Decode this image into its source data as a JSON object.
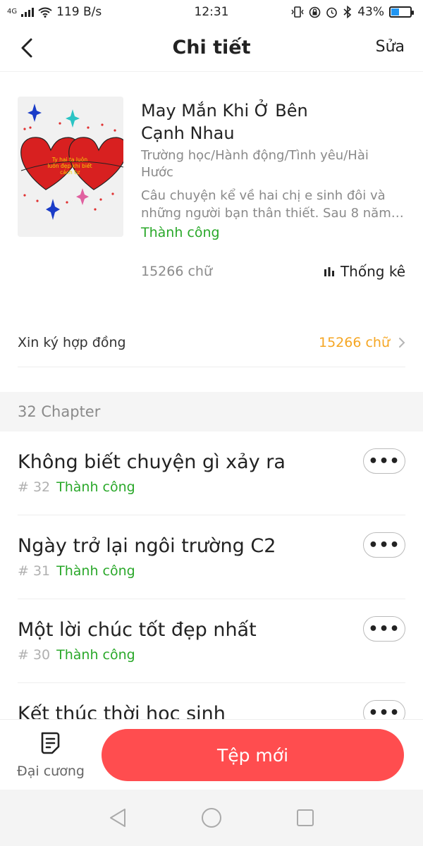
{
  "status_bar": {
    "network_type": "4G",
    "net_speed": "119 B/s",
    "time": "12:31",
    "battery_percent": "43%",
    "battery_level": 0.43,
    "battery_color": "#2196f3"
  },
  "header": {
    "title": "Chi tiết",
    "edit_label": "Sửa"
  },
  "book": {
    "cover_text": "Ty hai ta luôn luôn đẹp khi biết cách tự",
    "title": "May Mắn Khi Ở Bên Cạnh Nhau",
    "genres": "Trường học/Hành động/Tình yêu/Hài Hước",
    "description": "Câu chuyện kể về hai chị e sinh đôi và những người bạn thân thiết. Sau 8 năm g...",
    "status": "Thành công",
    "word_count": "15266 chữ",
    "stats_label": "Thống kê"
  },
  "contract": {
    "label": "Xin ký hợp đồng",
    "value": "15266 chữ"
  },
  "chapters": {
    "count_label": "32 Chapter",
    "items": [
      {
        "title": "Không biết chuyện gì xảy ra",
        "number": "# 32",
        "status": "Thành công"
      },
      {
        "title": "Ngày trở lại ngôi trường C2",
        "number": "# 31",
        "status": "Thành công"
      },
      {
        "title": "Một lời chúc tốt đẹp nhất",
        "number": "# 30",
        "status": "Thành công"
      },
      {
        "title": "Kết thúc thời học sinh",
        "number": "",
        "status": ""
      }
    ],
    "more_label": "•••"
  },
  "bottom_bar": {
    "outline_label": "Đại cương",
    "new_chapter_label": "Tệp mới"
  },
  "colors": {
    "accent_red": "#ff4d4f",
    "success_green": "#2aa82a",
    "highlight_orange": "#f5a623"
  },
  "icons": {
    "back": "chevron-left-icon",
    "stats": "bar-chart-icon",
    "contract_arrow": "chevron-right-icon",
    "outline": "document-icon",
    "nav_back": "triangle-back-icon",
    "nav_home": "circle-home-icon",
    "nav_recent": "square-recent-icon"
  }
}
